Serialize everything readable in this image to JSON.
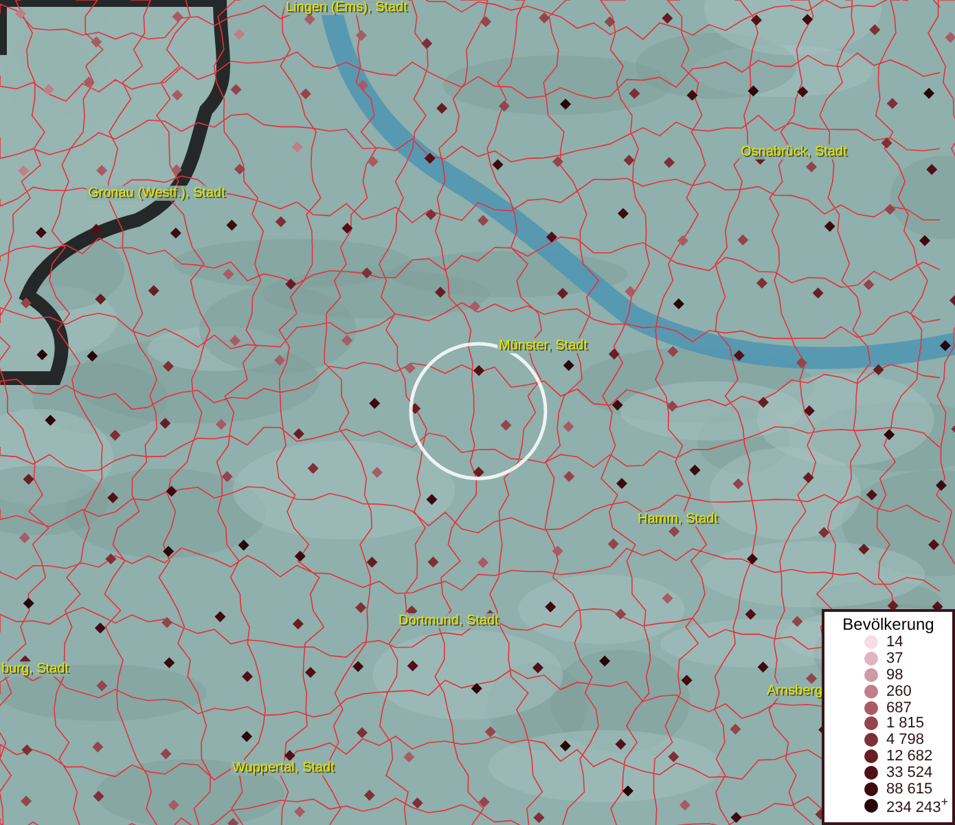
{
  "map": {
    "places": [
      {
        "label": "Lingen (Ems), Stadt"
      },
      {
        "label": "Osnabrück, Stadt"
      },
      {
        "label": "Gronau (Westf.), Stadt"
      },
      {
        "label": "Münster, Stadt"
      },
      {
        "label": "Hamm, Stadt"
      },
      {
        "label": "Dortmund, Stadt"
      },
      {
        "label": "burg, Stadt"
      },
      {
        "label": "Wuppertal, Stadt"
      },
      {
        "label": "Arnsberg"
      }
    ]
  },
  "legend": {
    "title": "Bevölkerung",
    "items": [
      {
        "label": "14",
        "color": "#f6dce6"
      },
      {
        "label": "37",
        "color": "#e2b4bf"
      },
      {
        "label": "98",
        "color": "#d09aa4"
      },
      {
        "label": "260",
        "color": "#bf7e88"
      },
      {
        "label": "687",
        "color": "#a85b64"
      },
      {
        "label": "1 815",
        "color": "#94444c"
      },
      {
        "label": "4 798",
        "color": "#7e2f37"
      },
      {
        "label": "12 682",
        "color": "#681d25"
      },
      {
        "label": "33 524",
        "color": "#511018"
      },
      {
        "label": "88 615",
        "color": "#3c0a10"
      },
      {
        "label": "234 243$^{+}$",
        "color": "#28050a"
      }
    ]
  }
}
